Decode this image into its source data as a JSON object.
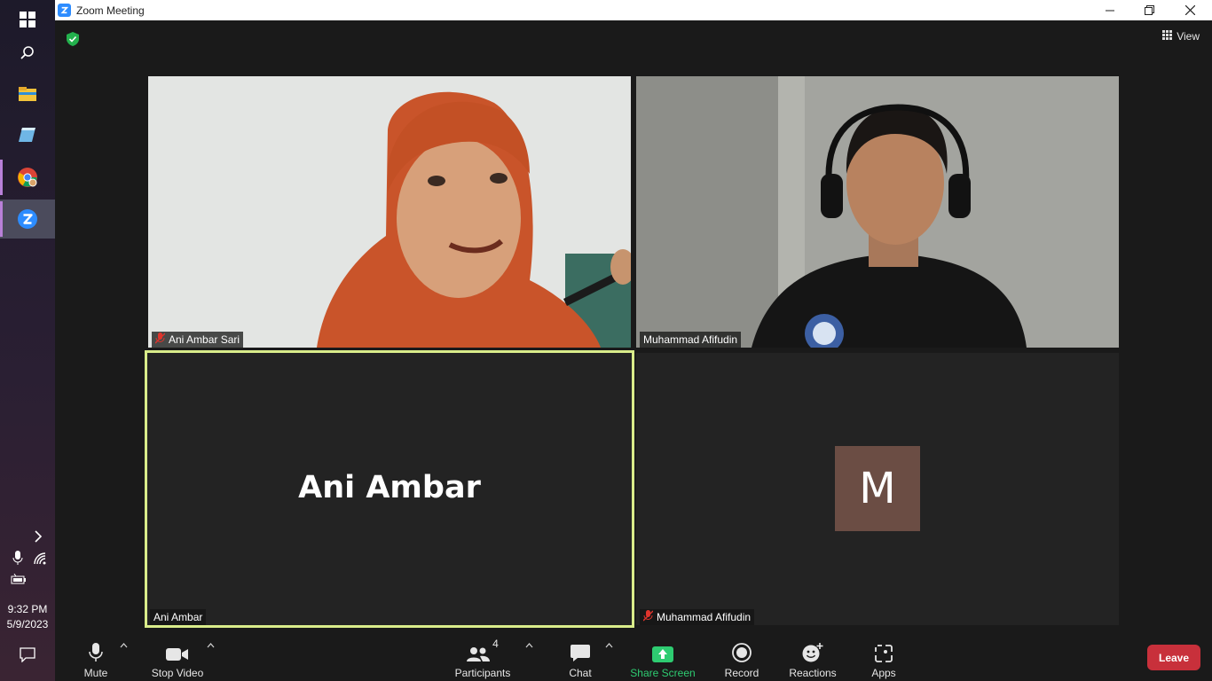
{
  "window": {
    "title": "Zoom Meeting"
  },
  "taskbar": {
    "icons": [
      "windows-start-icon",
      "search-icon",
      "file-explorer-icon",
      "notepad-icon",
      "chrome-icon",
      "zoom-icon"
    ],
    "clock_time": "9:32 PM",
    "clock_date": "5/9/2023"
  },
  "meeting": {
    "view_label": "View",
    "tiles": [
      {
        "name": "Ani Ambar Sari",
        "muted": true,
        "video": true
      },
      {
        "name": "Muhammad Afifudin",
        "muted": false,
        "video": true
      },
      {
        "name": "Ani Ambar",
        "muted": false,
        "video": false,
        "display_name": "Ani Ambar",
        "active_speaker": true
      },
      {
        "name": "Muhammad Afifudin",
        "muted": true,
        "video": false,
        "avatar_letter": "M"
      }
    ]
  },
  "toolbar": {
    "mute_label": "Mute",
    "stop_video_label": "Stop Video",
    "participants_label": "Participants",
    "participants_count": "4",
    "chat_label": "Chat",
    "share_screen_label": "Share Screen",
    "record_label": "Record",
    "reactions_label": "Reactions",
    "apps_label": "Apps",
    "leave_label": "Leave"
  },
  "colors": {
    "active_speaker_border": "#d9ec8a",
    "share_green": "#2ecc71",
    "leave_red": "#c8303b",
    "avatar_bg": "#6b4d44"
  }
}
